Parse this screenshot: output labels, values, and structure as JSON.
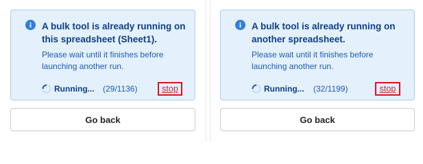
{
  "panels": [
    {
      "alert": {
        "icon": "info-icon",
        "title": "A bulk tool is already running on this spreadsheet (Sheet1).",
        "message": "Please wait until it finishes before launching another run.",
        "status_label": "Running...",
        "progress": "(29/1136)",
        "stop_label": "stop"
      },
      "back_label": "Go back"
    },
    {
      "alert": {
        "icon": "info-icon",
        "title": "A bulk tool is already running on another spreadsheet.",
        "message": "Please wait until it finishes before launching another run.",
        "status_label": "Running...",
        "progress": "(32/1199)",
        "stop_label": "stop"
      },
      "back_label": "Go back"
    }
  ],
  "colors": {
    "alert_background": "#e4f0fc",
    "alert_border": "#a9cdf3",
    "title_text": "#0d3f85",
    "body_text": "#1d5cb3",
    "info_icon": "#2f7de1",
    "stop_link": "#c62828",
    "highlight_box": "#d9141e"
  }
}
